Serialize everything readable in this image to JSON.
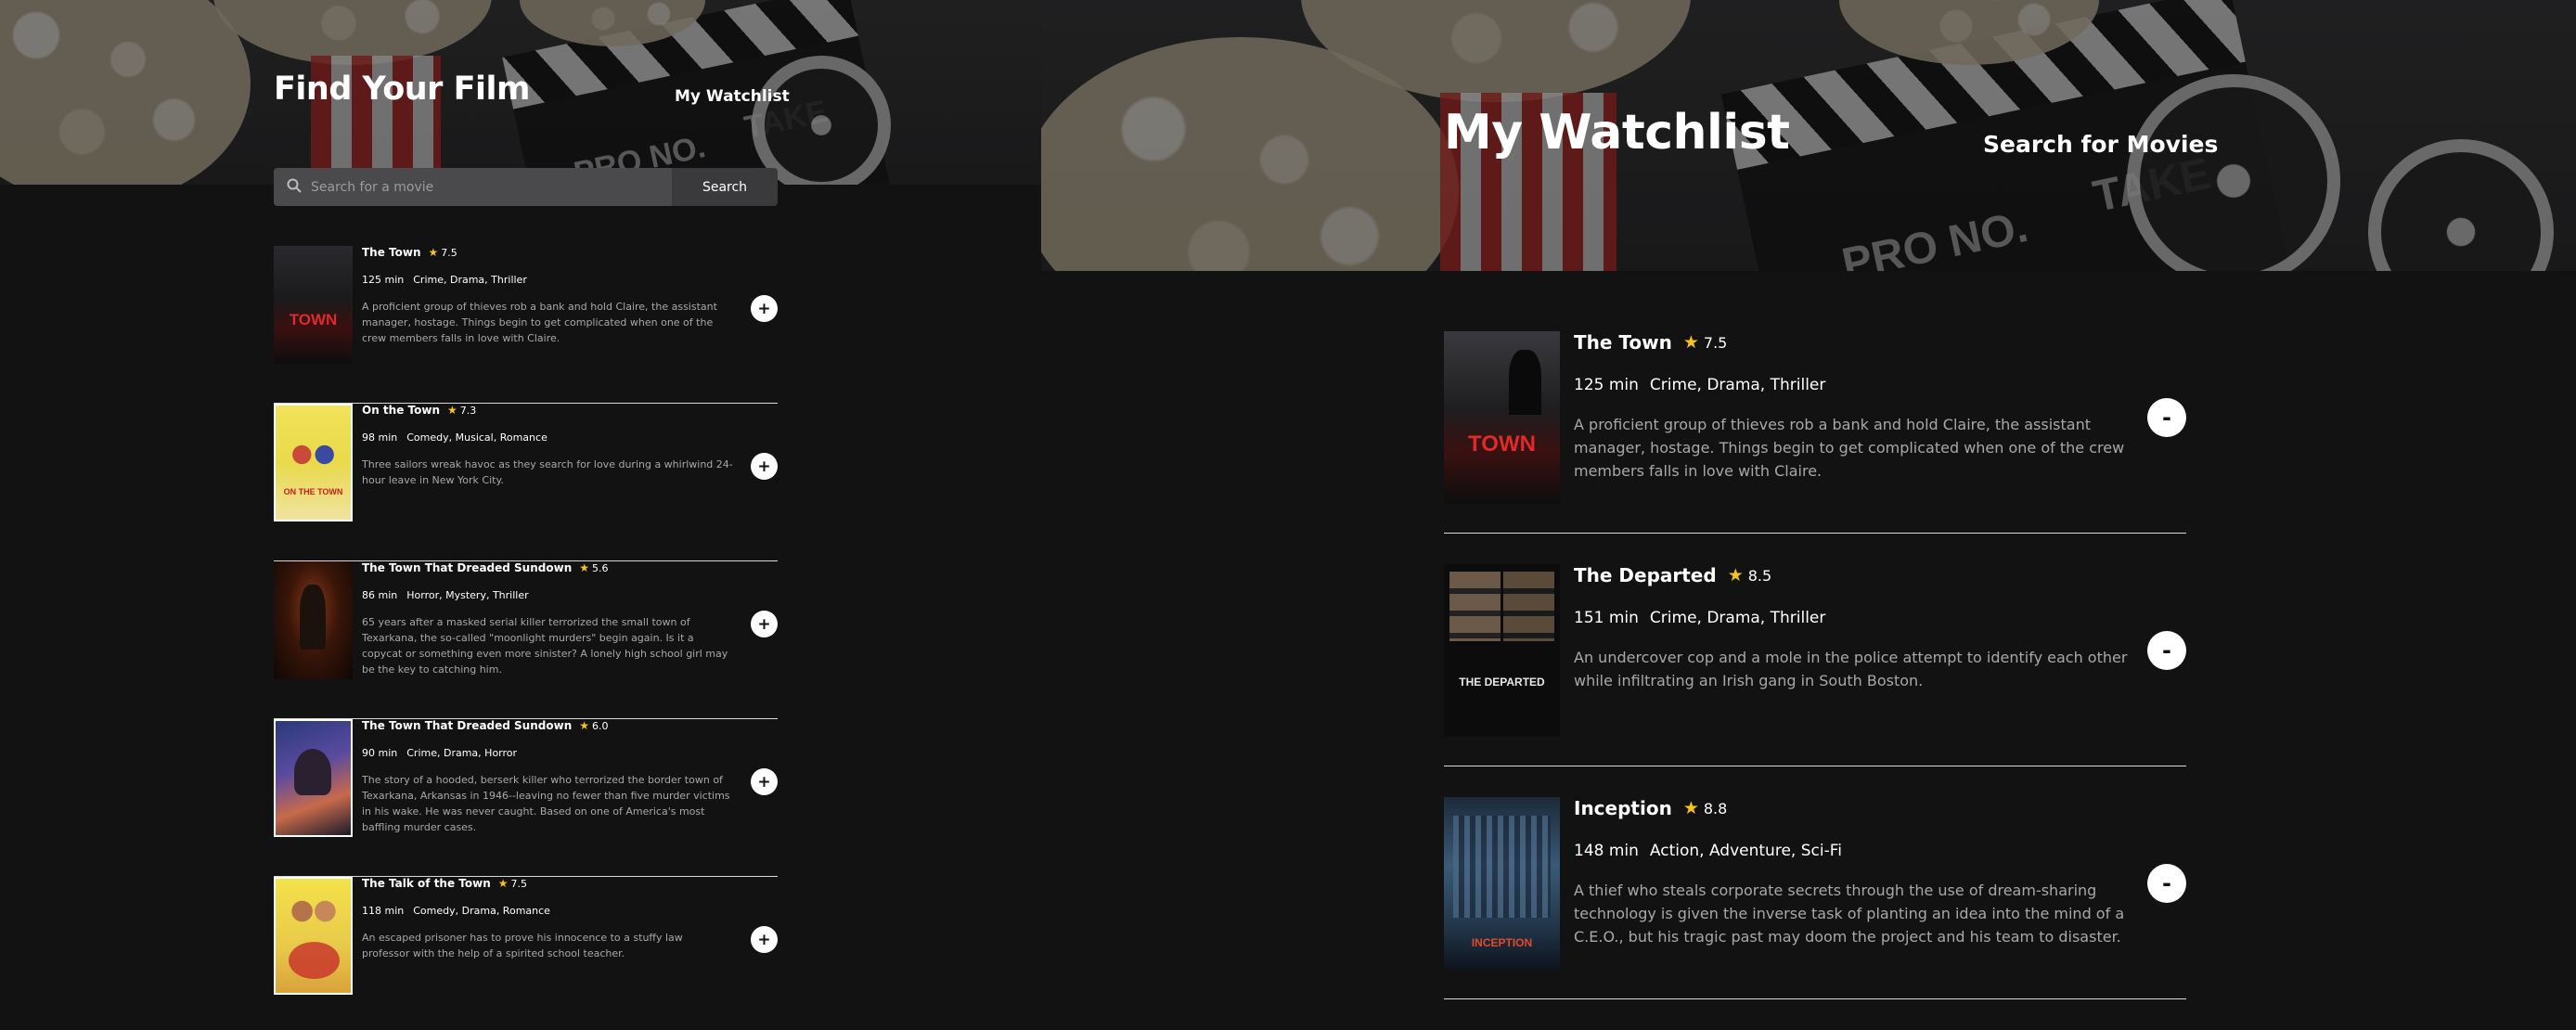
{
  "search_page": {
    "header": {
      "title": "Find Your Film",
      "nav_link": "My Watchlist"
    },
    "search": {
      "placeholder": "Search for a movie",
      "button_label": "Search"
    },
    "results": [
      {
        "title": "The Town",
        "rating": "7.5",
        "runtime": "125 min",
        "genres": "Crime, Drama, Thriller",
        "plot": "A proficient group of thieves rob a bank and hold Claire, the assistant manager, hostage. Things begin to get complicated when one of the crew members falls in love with Claire.",
        "action": "+"
      },
      {
        "title": "On the Town",
        "rating": "7.3",
        "runtime": "98 min",
        "genres": "Comedy, Musical, Romance",
        "plot": "Three sailors wreak havoc as they search for love during a whirlwind 24-hour leave in New York City.",
        "action": "+"
      },
      {
        "title": "The Town That Dreaded Sundown",
        "rating": "5.6",
        "runtime": "86 min",
        "genres": "Horror, Mystery, Thriller",
        "plot": "65 years after a masked serial killer terrorized the small town of Texarkana, the so-called \"moonlight murders\" begin again. Is it a copycat or something even more sinister? A lonely high school girl may be the key to catching him.",
        "action": "+"
      },
      {
        "title": "The Town That Dreaded Sundown",
        "rating": "6.0",
        "runtime": "90 min",
        "genres": "Crime, Drama, Horror",
        "plot": "The story of a hooded, berserk killer who terrorized the border town of Texarkana, Arkansas in 1946--leaving no fewer than five murder victims in his wake. He was never caught. Based on one of America's most baffling murder cases.",
        "action": "+"
      },
      {
        "title": "The Talk of the Town",
        "rating": "7.5",
        "runtime": "118 min",
        "genres": "Comedy, Drama, Romance",
        "plot": "An escaped prisoner has to prove his innocence to a stuffy law professor with the help of a spirited school teacher.",
        "action": "+"
      }
    ]
  },
  "watchlist_page": {
    "header": {
      "title": "My Watchlist",
      "nav_link": "Search for Movies"
    },
    "items": [
      {
        "title": "The Town",
        "rating": "7.5",
        "runtime": "125 min",
        "genres": "Crime, Drama, Thriller",
        "plot": "A proficient group of thieves rob a bank and hold Claire, the assistant manager, hostage. Things begin to get complicated when one of the crew members falls in love with Claire.",
        "action": "-"
      },
      {
        "title": "The Departed",
        "rating": "8.5",
        "runtime": "151 min",
        "genres": "Crime, Drama, Thriller",
        "plot": "An undercover cop and a mole in the police attempt to identify each other while infiltrating an Irish gang in South Boston.",
        "action": "-"
      },
      {
        "title": "Inception",
        "rating": "8.8",
        "runtime": "148 min",
        "genres": "Action, Adventure, Sci-Fi",
        "plot": "A thief who steals corporate secrets through the use of dream-sharing technology is given the inverse task of planting an idea into the mind of a C.E.O., but his tragic past may doom the project and his team to disaster.",
        "action": "-"
      }
    ]
  },
  "posters": {
    "town": "TOWN",
    "on_the_town": "ON THE TOWN",
    "departed": "THE DEPARTED",
    "inception": "INCEPTION"
  },
  "backdrop": {
    "clapper_text": "PRO NO.",
    "clapper_text_2": "TAKE"
  },
  "icons": {
    "search": "search-icon",
    "star": "star-icon"
  },
  "colors": {
    "background": "#121212",
    "star": "#f5c518",
    "divider": "#d9d9d9",
    "search_field": "#4a4a4c",
    "search_button": "#3a3a3c"
  }
}
